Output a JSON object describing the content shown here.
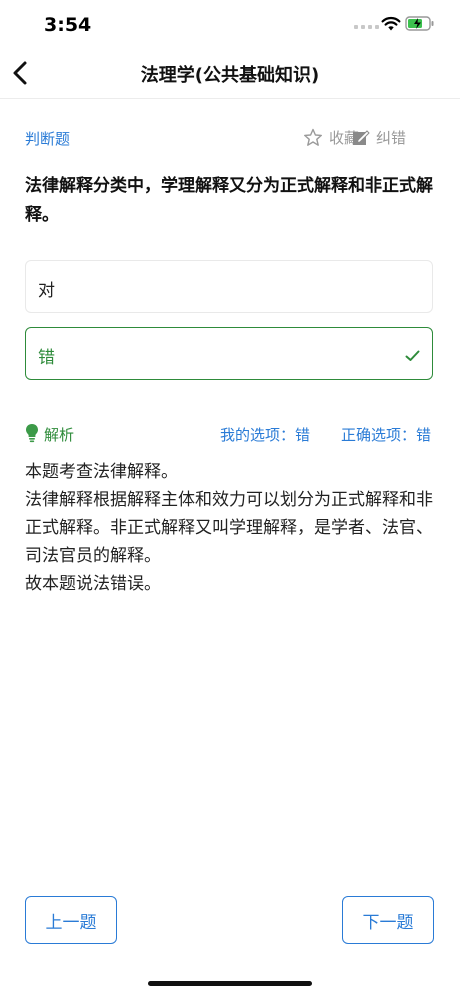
{
  "status": {
    "time": "3:54"
  },
  "header": {
    "title": "法理学(公共基础知识)"
  },
  "question": {
    "type": "判断题",
    "text": "法律解释分类中，学理解释又分为正式解释和非正式解释。",
    "favorite_label": "收藏",
    "correct_label": "纠错"
  },
  "options": [
    {
      "label": "对"
    },
    {
      "label": "错"
    }
  ],
  "analysis": {
    "label": "解析",
    "my_choice": "我的选项：错",
    "correct_answer": "正确选项：错",
    "lines": [
      "本题考查法律解释。",
      "法律解释根据解释主体和效力可以划分为正式解释和非正式解释。非正式解释又叫学理解释，是学者、法官、司法官员的解释。",
      "故本题说法错误。"
    ]
  },
  "footer": {
    "prev_label": "上一题",
    "next_label": "下一题"
  },
  "colors": {
    "accent_blue": "#2a7bd6",
    "correct_green": "#2e8b3a"
  }
}
